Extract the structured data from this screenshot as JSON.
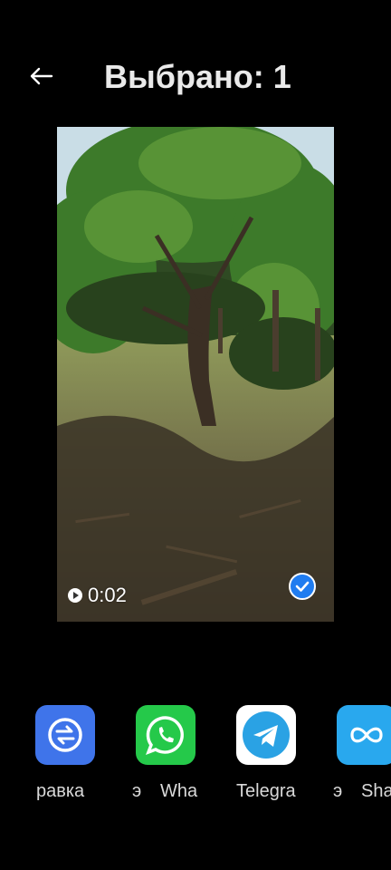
{
  "header": {
    "title": "Выбрано: 1"
  },
  "media": {
    "duration": "0:02",
    "selected": true
  },
  "share": {
    "apps": [
      {
        "label": "равка",
        "icon": "swap-icon",
        "color": "#3f74ea"
      },
      {
        "label": "Wha",
        "icon": "whatsapp-icon",
        "color": "#25c94a"
      },
      {
        "label": "Telegra",
        "icon": "telegram-icon",
        "color": "#ffffff"
      },
      {
        "label": "Sha",
        "icon": "infinity-icon",
        "color": "#29a8ee"
      }
    ],
    "fragments": [
      "",
      "э",
      "э"
    ]
  }
}
